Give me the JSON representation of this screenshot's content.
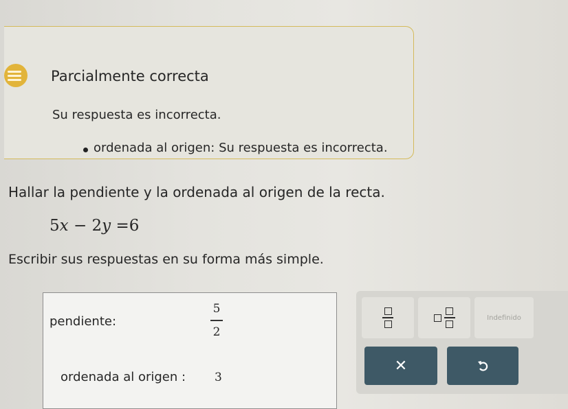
{
  "feedback": {
    "title": "Parcialmente correcta",
    "message": "Su respuesta es incorrecta.",
    "items": [
      "ordenada al origen: Su respuesta es incorrecta."
    ],
    "accent_color": "#e2b43a"
  },
  "problem": {
    "question": "Hallar la pendiente y la ordenada al origen de la recta.",
    "equation": {
      "a": "5",
      "x": "x",
      "op": "−",
      "b": "2",
      "y": "y",
      "eq": "=",
      "c": "6"
    },
    "instruction": "Escribir sus respuestas en su forma más simple."
  },
  "answers": {
    "slope_label": "pendiente:",
    "slope_numerator": "5",
    "slope_denominator": "2",
    "intercept_label": "ordenada al origen :",
    "intercept_value": "3"
  },
  "keypad": {
    "keys": [
      {
        "name": "fraction",
        "icon": "fraction-icon"
      },
      {
        "name": "mixed-number",
        "icon": "mixed-number-icon"
      },
      {
        "name": "undefined",
        "label": "Indefinido"
      }
    ],
    "clear_symbol": "✕",
    "undo_icon": "undo-icon",
    "action_color": "#3e5966"
  }
}
